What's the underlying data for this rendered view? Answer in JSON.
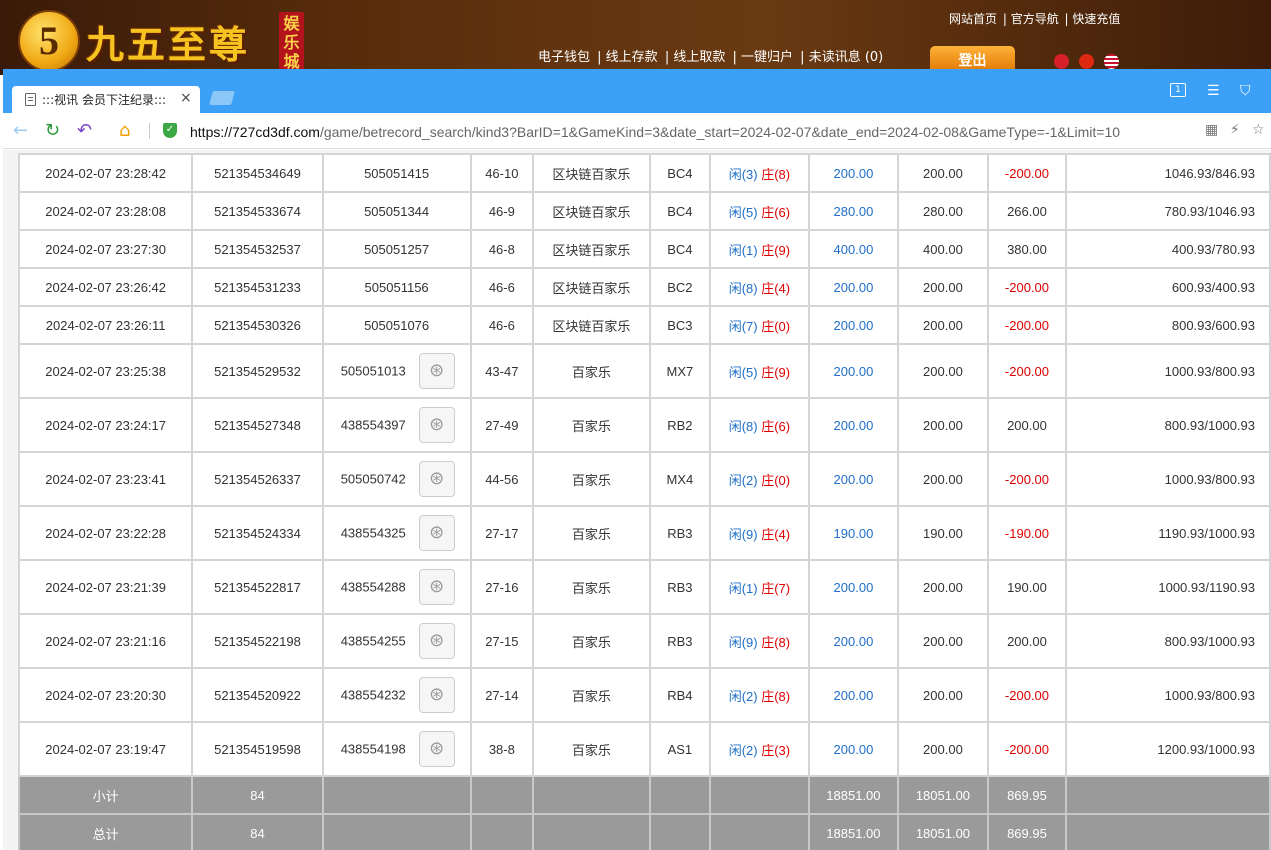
{
  "site": {
    "logo_mark": "5",
    "logo_text": "九五至尊",
    "logo_badge": "娱乐城",
    "top_links": [
      "网站首页",
      "官方导航",
      "快速充值"
    ],
    "nav_links": [
      "电子钱包",
      "线上存款",
      "线上取款",
      "一键归户",
      "未读讯息 (0)"
    ],
    "logout": "登出"
  },
  "browser": {
    "tab_title": ":::视讯 会员下注纪录:::",
    "tab_close": "×",
    "window_box_label": "1",
    "url_host": "https://727cd3df.com",
    "url_rest": "/game/betrecord_search/kind3?BarID=1&GameKind=3&date_start=2024-02-07&date_end=2024-02-08&GameType=-1&Limit=10"
  },
  "icons": {
    "back": "←",
    "refresh": "↻",
    "undo": "↶",
    "home": "⌂",
    "shield": "✓",
    "qr": "▦",
    "bolt": "⚡",
    "star": "☆",
    "menu": "☰",
    "shirt": "⛉",
    "video": "⊛"
  },
  "table": {
    "rows": [
      {
        "time": "2024-02-07 23:28:42",
        "bet_id": "521354534649",
        "round_id": "505051415",
        "video": false,
        "shoe": "46-10",
        "game": "区块链百家乐",
        "table": "BC4",
        "player": "闲(3)",
        "banker": "庄(8)",
        "bet": "200.00",
        "valid": "200.00",
        "result": "-200.00",
        "balance": "1046.93/846.93"
      },
      {
        "time": "2024-02-07 23:28:08",
        "bet_id": "521354533674",
        "round_id": "505051344",
        "video": false,
        "shoe": "46-9",
        "game": "区块链百家乐",
        "table": "BC4",
        "player": "闲(5)",
        "banker": "庄(6)",
        "bet": "280.00",
        "valid": "280.00",
        "result": "266.00",
        "balance": "780.93/1046.93"
      },
      {
        "time": "2024-02-07 23:27:30",
        "bet_id": "521354532537",
        "round_id": "505051257",
        "video": false,
        "shoe": "46-8",
        "game": "区块链百家乐",
        "table": "BC4",
        "player": "闲(1)",
        "banker": "庄(9)",
        "bet": "400.00",
        "valid": "400.00",
        "result": "380.00",
        "balance": "400.93/780.93"
      },
      {
        "time": "2024-02-07 23:26:42",
        "bet_id": "521354531233",
        "round_id": "505051156",
        "video": false,
        "shoe": "46-6",
        "game": "区块链百家乐",
        "table": "BC2",
        "player": "闲(8)",
        "banker": "庄(4)",
        "bet": "200.00",
        "valid": "200.00",
        "result": "-200.00",
        "balance": "600.93/400.93"
      },
      {
        "time": "2024-02-07 23:26:11",
        "bet_id": "521354530326",
        "round_id": "505051076",
        "video": false,
        "shoe": "46-6",
        "game": "区块链百家乐",
        "table": "BC3",
        "player": "闲(7)",
        "banker": "庄(0)",
        "bet": "200.00",
        "valid": "200.00",
        "result": "-200.00",
        "balance": "800.93/600.93"
      },
      {
        "time": "2024-02-07 23:25:38",
        "bet_id": "521354529532",
        "round_id": "505051013",
        "video": true,
        "shoe": "43-47",
        "game": "百家乐",
        "table": "MX7",
        "player": "闲(5)",
        "banker": "庄(9)",
        "bet": "200.00",
        "valid": "200.00",
        "result": "-200.00",
        "balance": "1000.93/800.93"
      },
      {
        "time": "2024-02-07 23:24:17",
        "bet_id": "521354527348",
        "round_id": "438554397",
        "video": true,
        "shoe": "27-49",
        "game": "百家乐",
        "table": "RB2",
        "player": "闲(8)",
        "banker": "庄(6)",
        "bet": "200.00",
        "valid": "200.00",
        "result": "200.00",
        "balance": "800.93/1000.93"
      },
      {
        "time": "2024-02-07 23:23:41",
        "bet_id": "521354526337",
        "round_id": "505050742",
        "video": true,
        "shoe": "44-56",
        "game": "百家乐",
        "table": "MX4",
        "player": "闲(2)",
        "banker": "庄(0)",
        "bet": "200.00",
        "valid": "200.00",
        "result": "-200.00",
        "balance": "1000.93/800.93"
      },
      {
        "time": "2024-02-07 23:22:28",
        "bet_id": "521354524334",
        "round_id": "438554325",
        "video": true,
        "shoe": "27-17",
        "game": "百家乐",
        "table": "RB3",
        "player": "闲(9)",
        "banker": "庄(4)",
        "bet": "190.00",
        "valid": "190.00",
        "result": "-190.00",
        "balance": "1190.93/1000.93"
      },
      {
        "time": "2024-02-07 23:21:39",
        "bet_id": "521354522817",
        "round_id": "438554288",
        "video": true,
        "shoe": "27-16",
        "game": "百家乐",
        "table": "RB3",
        "player": "闲(1)",
        "banker": "庄(7)",
        "bet": "200.00",
        "valid": "200.00",
        "result": "190.00",
        "balance": "1000.93/1190.93"
      },
      {
        "time": "2024-02-07 23:21:16",
        "bet_id": "521354522198",
        "round_id": "438554255",
        "video": true,
        "shoe": "27-15",
        "game": "百家乐",
        "table": "RB3",
        "player": "闲(9)",
        "banker": "庄(8)",
        "bet": "200.00",
        "valid": "200.00",
        "result": "200.00",
        "balance": "800.93/1000.93"
      },
      {
        "time": "2024-02-07 23:20:30",
        "bet_id": "521354520922",
        "round_id": "438554232",
        "video": true,
        "shoe": "27-14",
        "game": "百家乐",
        "table": "RB4",
        "player": "闲(2)",
        "banker": "庄(8)",
        "bet": "200.00",
        "valid": "200.00",
        "result": "-200.00",
        "balance": "1000.93/800.93"
      },
      {
        "time": "2024-02-07 23:19:47",
        "bet_id": "521354519598",
        "round_id": "438554198",
        "video": true,
        "shoe": "38-8",
        "game": "百家乐",
        "table": "AS1",
        "player": "闲(2)",
        "banker": "庄(3)",
        "bet": "200.00",
        "valid": "200.00",
        "result": "-200.00",
        "balance": "1200.93/1000.93"
      }
    ],
    "subtotal": {
      "label": "小计",
      "count": "84",
      "bet": "18851.00",
      "valid": "18051.00",
      "result": "869.95"
    },
    "total": {
      "label": "总计",
      "count": "84",
      "bet": "18851.00",
      "valid": "18051.00",
      "result": "869.95"
    }
  },
  "colors": {
    "tabbar": "#3ba0f6",
    "positive_blue": "#1f6fc8",
    "negative_red": "#e00000",
    "total_row": "#9a9a9a"
  }
}
